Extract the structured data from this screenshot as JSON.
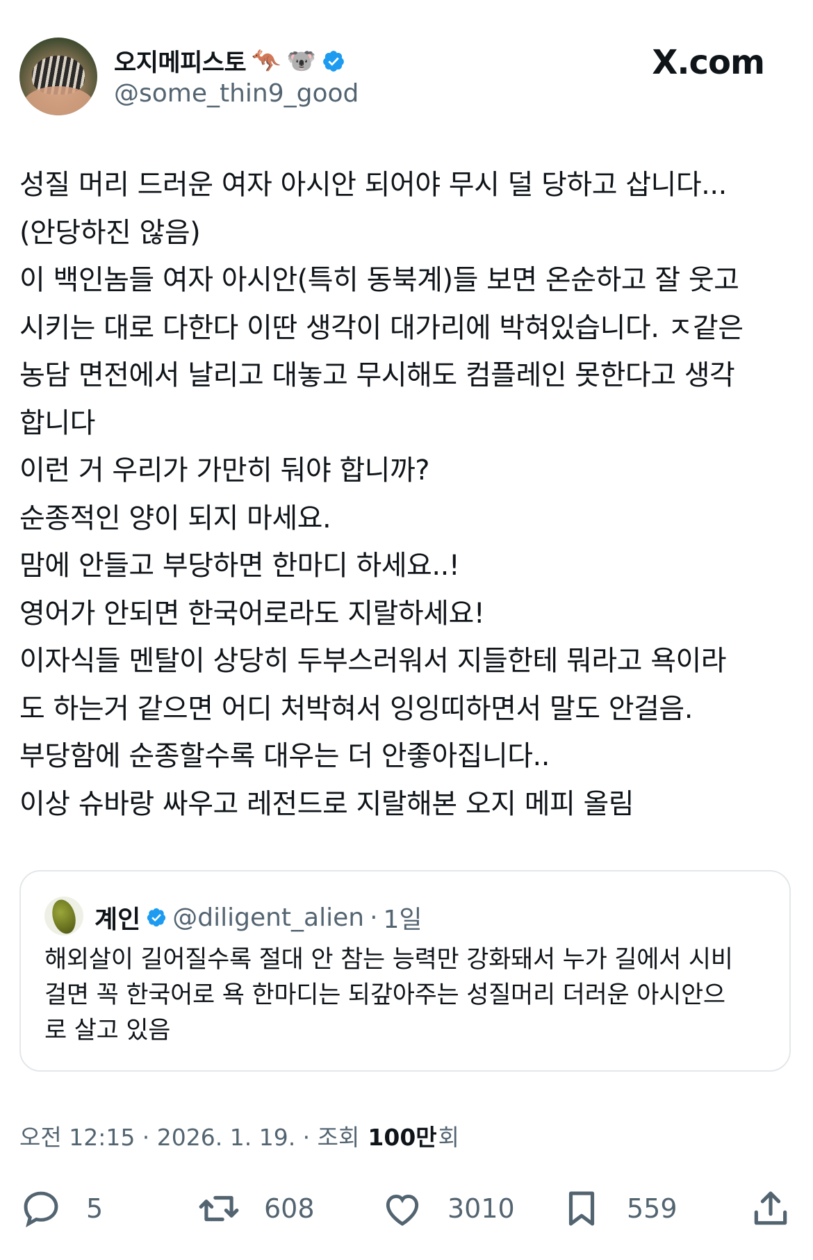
{
  "author": {
    "display_name": "오지메피스토",
    "emoji_1": "🦘",
    "emoji_2": "🐨",
    "handle": "@some_thin9_good"
  },
  "brand": "X.com",
  "tweet_text": "성질 머리 드러운 여자 아시안 되어야 무시 덜 당하고 삽니다...\n(안당하진 않음)\n이 백인놈들 여자 아시안(특히 동북계)들 보면 온순하고 잘 웃고\n시키는 대로 다한다 이딴 생각이 대가리에 박혀있습니다. ㅈ같은\n농담 면전에서 날리고 대놓고 무시해도 컴플레인 못한다고 생각\n합니다\n이런 거 우리가 가만히 둬야 합니까?\n순종적인 양이 되지 마세요.\n맘에 안들고 부당하면 한마디 하세요..!\n영어가 안되면 한국어로라도 지랄하세요!\n이자식들 멘탈이 상당히 두부스러워서 지들한테 뭐라고 욕이라\n도 하는거 같으면 어디 처박혀서 잉잉띠하면서 말도 안걸음.\n부당함에 순종할수록 대우는 더 안좋아집니다..\n이상 슈바랑 싸우고 레전드로 지랄해본 오지 메피 올림",
  "quote": {
    "display_name": "계인",
    "handle": "@diligent_alien",
    "separator": "·",
    "time": "1일",
    "text": "해외살이 길어질수록 절대 안 참는 능력만 강화돼서 누가 길에서 시비\n걸면 꼭 한국어로 욕 한마디는 되갚아주는 성질머리 더러운 아시안으\n로 살고 있음"
  },
  "meta": {
    "time_date": "오전 12:15 · 2026. 1. 19. · 조회",
    "views": "100만",
    "views_suffix": "회"
  },
  "actions": {
    "replies": "5",
    "reposts": "608",
    "likes": "3010",
    "bookmarks": "559"
  },
  "colors": {
    "verified": "#1d9bf0",
    "secondary_text": "#536471",
    "primary_text": "#0f1419",
    "quote_border": "#e3e7ea"
  }
}
